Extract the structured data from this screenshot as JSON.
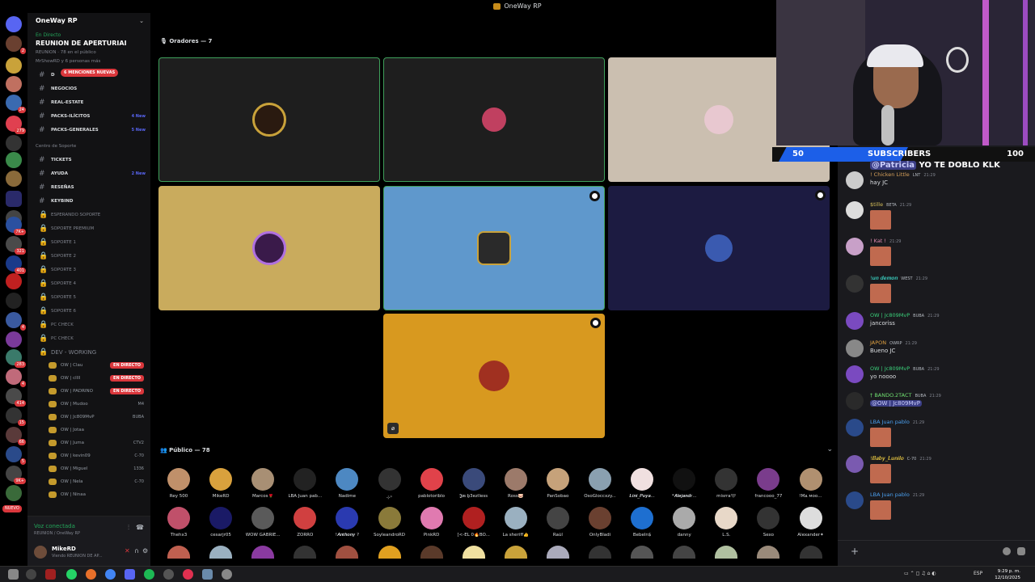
{
  "window": {
    "title": "OneWay RP"
  },
  "server": {
    "name": "OneWay RP"
  },
  "event": {
    "live_label": "En Directo",
    "title": "REUNION DE APERTURIAI",
    "line1": "REUNION · 78 en el público",
    "line2": "MrShowRD y 6 personas más"
  },
  "rail_badges": [
    "2",
    "",
    "",
    "24",
    "279",
    "",
    "",
    "",
    "",
    "",
    "",
    "7K+",
    "321",
    "401",
    "",
    "",
    "4",
    "",
    "283",
    "4",
    "414",
    "15",
    "66",
    "5",
    "9K+"
  ],
  "rail_nuevo": "NUEVO",
  "mentions_badge": "6 MENCIONES NUEVAS",
  "channels": [
    {
      "name": "D",
      "tag": ""
    },
    {
      "name": "NEGOCIOS",
      "tag": ""
    },
    {
      "name": "REAL-ESTATE",
      "tag": ""
    },
    {
      "name": "PACKS-ILÍCITOS",
      "tag": "4 New"
    },
    {
      "name": "PACKS-GENERALES",
      "tag": "5 New"
    }
  ],
  "support_category": "Centro de Soporte",
  "support_channels": [
    {
      "name": "TICKETS",
      "tag": ""
    },
    {
      "name": "AYUDA",
      "tag": "2 New"
    },
    {
      "name": "RESEÑAS",
      "tag": ""
    },
    {
      "name": "KEYBIND",
      "tag": ""
    }
  ],
  "voice_channels": [
    "ESPERANDO SOPORTE",
    "SOPORTE PREMIUM",
    "SOPORTE 1",
    "SOPORTE 2",
    "SOPORTE 3",
    "SOPORTE 4",
    "SOPORTE 5",
    "SOPORTE 6",
    "PC CHECK",
    "PC CHECK",
    "DEV - WORKING"
  ],
  "voice_users": [
    {
      "name": "OW | Clau",
      "badge": "EN DIRECTO"
    },
    {
      "name": "OW | cllll",
      "badge": "EN DIRECTO"
    },
    {
      "name": "OW | PADRINO",
      "badge": "EN DIRECTO"
    },
    {
      "name": "OW | Mudoo",
      "extra": "M4"
    },
    {
      "name": "OW | Jc809MvP",
      "extra": "BUBA"
    },
    {
      "name": "OW | Jotaa",
      "extra": ""
    },
    {
      "name": "OW | Juma",
      "extra": "CTV2"
    },
    {
      "name": "OW | kevin09",
      "extra": "C-70"
    },
    {
      "name": "OW | Miguel",
      "extra": "1336"
    },
    {
      "name": "OW | Nela",
      "extra": "C-70"
    },
    {
      "name": "OW | Ninaa",
      "extra": ""
    }
  ],
  "connection": {
    "status": "Voz conectada",
    "channel": "REUNION / OneWay RP"
  },
  "user": {
    "name": "MikeRD",
    "status": "Viendo REUNION DE AP..."
  },
  "stage": {
    "speakers_label": "Oradores — 7",
    "audience_label": "Público — 78"
  },
  "colors": {
    "tile_dark": "#1e1e1e",
    "tile_beige": "#cbbfb0",
    "tile_gold": "#c9ab5d",
    "tile_blue": "#5f98cc",
    "tile_navy": "#1c1b41",
    "tile_orange": "#d8991f",
    "speaking": "#3fa05b",
    "chat_bg": "#1a1a1e",
    "sub_blue": "#1c5fe8"
  },
  "audience": [
    {
      "name": "Rey 500",
      "color": "#c0906a"
    },
    {
      "name": "MikeRD",
      "color": "#d9a13d"
    },
    {
      "name": "Marcos🌹",
      "color": "#a88f74"
    },
    {
      "name": "LBA Juan pab...",
      "color": "#222"
    },
    {
      "name": "Nadime",
      "color": "#4d88c2"
    },
    {
      "name": "⊹꙳",
      "color": "#333"
    },
    {
      "name": "pablotoriblo",
      "color": "#e0424a"
    },
    {
      "name": "𝕵𝖒 ḇ3ezlless",
      "color": "#3a4a7a"
    },
    {
      "name": "Ross🐷",
      "color": "#9c7a6a"
    },
    {
      "name": "PanSobao",
      "color": "#c6a27a"
    },
    {
      "name": "OsoGloccxzy...",
      "color": "#8aa0b0"
    },
    {
      "name": "𝑳𝒊𝒏𝒊_𝑷𝒖𝒚𝒂...",
      "color": "#f0e0e0"
    },
    {
      "name": "*𝑨𝒍𝒆𝒋𝒂𝒏𝒅𝒓...",
      "color": "#111"
    },
    {
      "name": "misrra🖤",
      "color": "#333"
    },
    {
      "name": "francooo_77",
      "color": "#7a3c8c"
    },
    {
      "name": "!Mᴀ ᴍᴏᴏ...",
      "color": "#b09070"
    },
    {
      "name": "Thehx3",
      "color": "#c0506a"
    },
    {
      "name": "cesarjr05",
      "color": "#1a1a66"
    },
    {
      "name": "WOW GABRIE...",
      "color": "#5a5a5a"
    },
    {
      "name": "ZORRO",
      "color": "#d04040"
    },
    {
      "name": "!𝑨𝒏𝒕𝒉𝒐𝒏𝒚 ?",
      "color": "#2a3ab0"
    },
    {
      "name": "SoyleandroRD",
      "color": "#8a7a3a"
    },
    {
      "name": "PinkRD",
      "color": "#e07ab0"
    },
    {
      "name": "[<-EL 0🔥BO...",
      "color": "#b02020"
    },
    {
      "name": "La sheriff👍",
      "color": "#9ab0c0"
    },
    {
      "name": "Raúl",
      "color": "#444"
    },
    {
      "name": "OnlyBladi",
      "color": "#6a4030"
    },
    {
      "name": "Bebeln$",
      "color": "#1e6fd0"
    },
    {
      "name": "danny",
      "color": "#aaa"
    },
    {
      "name": "L.S.",
      "color": "#e8d8c8"
    },
    {
      "name": "Sexo",
      "color": "#333"
    },
    {
      "name": "Alexander✦",
      "color": "#ddd"
    }
  ],
  "chat": {
    "top_message": {
      "mention": "@Patricia",
      "text": "YO TE DOBLO KLK"
    },
    "messages": [
      {
        "name": "! Chicken Little",
        "badge": "LNT",
        "time": "21:29",
        "text": "hay JC",
        "color": "#d6a05a"
      },
      {
        "name": "$tille",
        "badge": "BETA",
        "time": "21:29",
        "text": "",
        "color": "#d6c05a"
      },
      {
        "name": "! Kat !",
        "badge": "",
        "time": "21:29",
        "text": "",
        "color": "#e08ab0"
      },
      {
        "name": "!𝒖𝒏 𝒅𝒆𝒎𝒐𝒏",
        "badge": "WEST",
        "time": "21:29",
        "text": "",
        "color": "#3ad0c0"
      },
      {
        "name": "OW | Jc809MvP",
        "badge": "BUBA",
        "time": "21:29",
        "text": "jancoriss",
        "color": "#3ad07a"
      },
      {
        "name": "JAPON",
        "badge": "OWRP",
        "time": "21:29",
        "text": "Bueno JC",
        "color": "#e0a040"
      },
      {
        "name": "OW | Jc809MvP",
        "badge": "BUBA",
        "time": "21:29",
        "text": "yo noooo",
        "color": "#3ad07a"
      },
      {
        "name": "† BANDO.2TACT",
        "badge": "BUBA",
        "time": "21:29",
        "text": "@OW | Jc809MvP",
        "color": "#70e070"
      },
      {
        "name": "LBA Juan pablo",
        "badge": "",
        "time": "21:29",
        "text": "",
        "color": "#4aa0f0"
      },
      {
        "name": "!𝑩𝒂𝒃𝒚_𝑳𝒖𝒏𝒊𝒍𝒐",
        "badge": "C-70",
        "time": "21:29",
        "text": "",
        "color": "#e0c040"
      },
      {
        "name": "LBA Juan pablo",
        "badge": "",
        "time": "21:29",
        "text": "",
        "color": "#4aa0f0"
      }
    ]
  },
  "overlay": {
    "left_count": "50",
    "label": "SUBSCRIBERS",
    "right_count": "100",
    "progress_fraction": 0.5
  },
  "taskbar": {
    "lang": "ESP",
    "time": "9:29 p. m.",
    "date": "12/10/2025"
  }
}
